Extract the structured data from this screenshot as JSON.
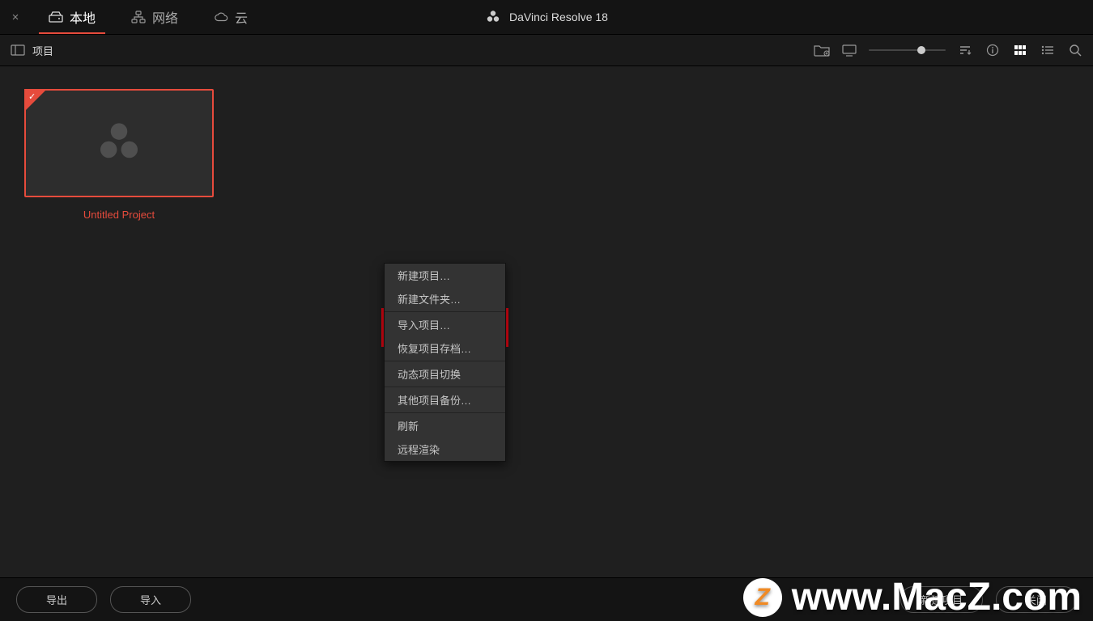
{
  "app": {
    "title": "DaVinci Resolve 18"
  },
  "tabs": {
    "local": "本地",
    "network": "网络",
    "cloud": "云"
  },
  "subbar": {
    "label": "项目"
  },
  "project": {
    "name": "Untitled Project"
  },
  "context_menu": {
    "new_project": "新建项目…",
    "new_folder": "新建文件夹…",
    "import_project": "导入项目…",
    "restore_archive": "恢复项目存档…",
    "dynamic_switch": "动态项目切换",
    "other_backups": "其他项目备份…",
    "refresh": "刷新",
    "remote_render": "远程渲染"
  },
  "footer": {
    "export": "导出",
    "import": "导入",
    "new_project": "新建项目",
    "close": "关闭"
  },
  "watermark": {
    "letter": "Z",
    "text": "www.MacZ.com"
  }
}
